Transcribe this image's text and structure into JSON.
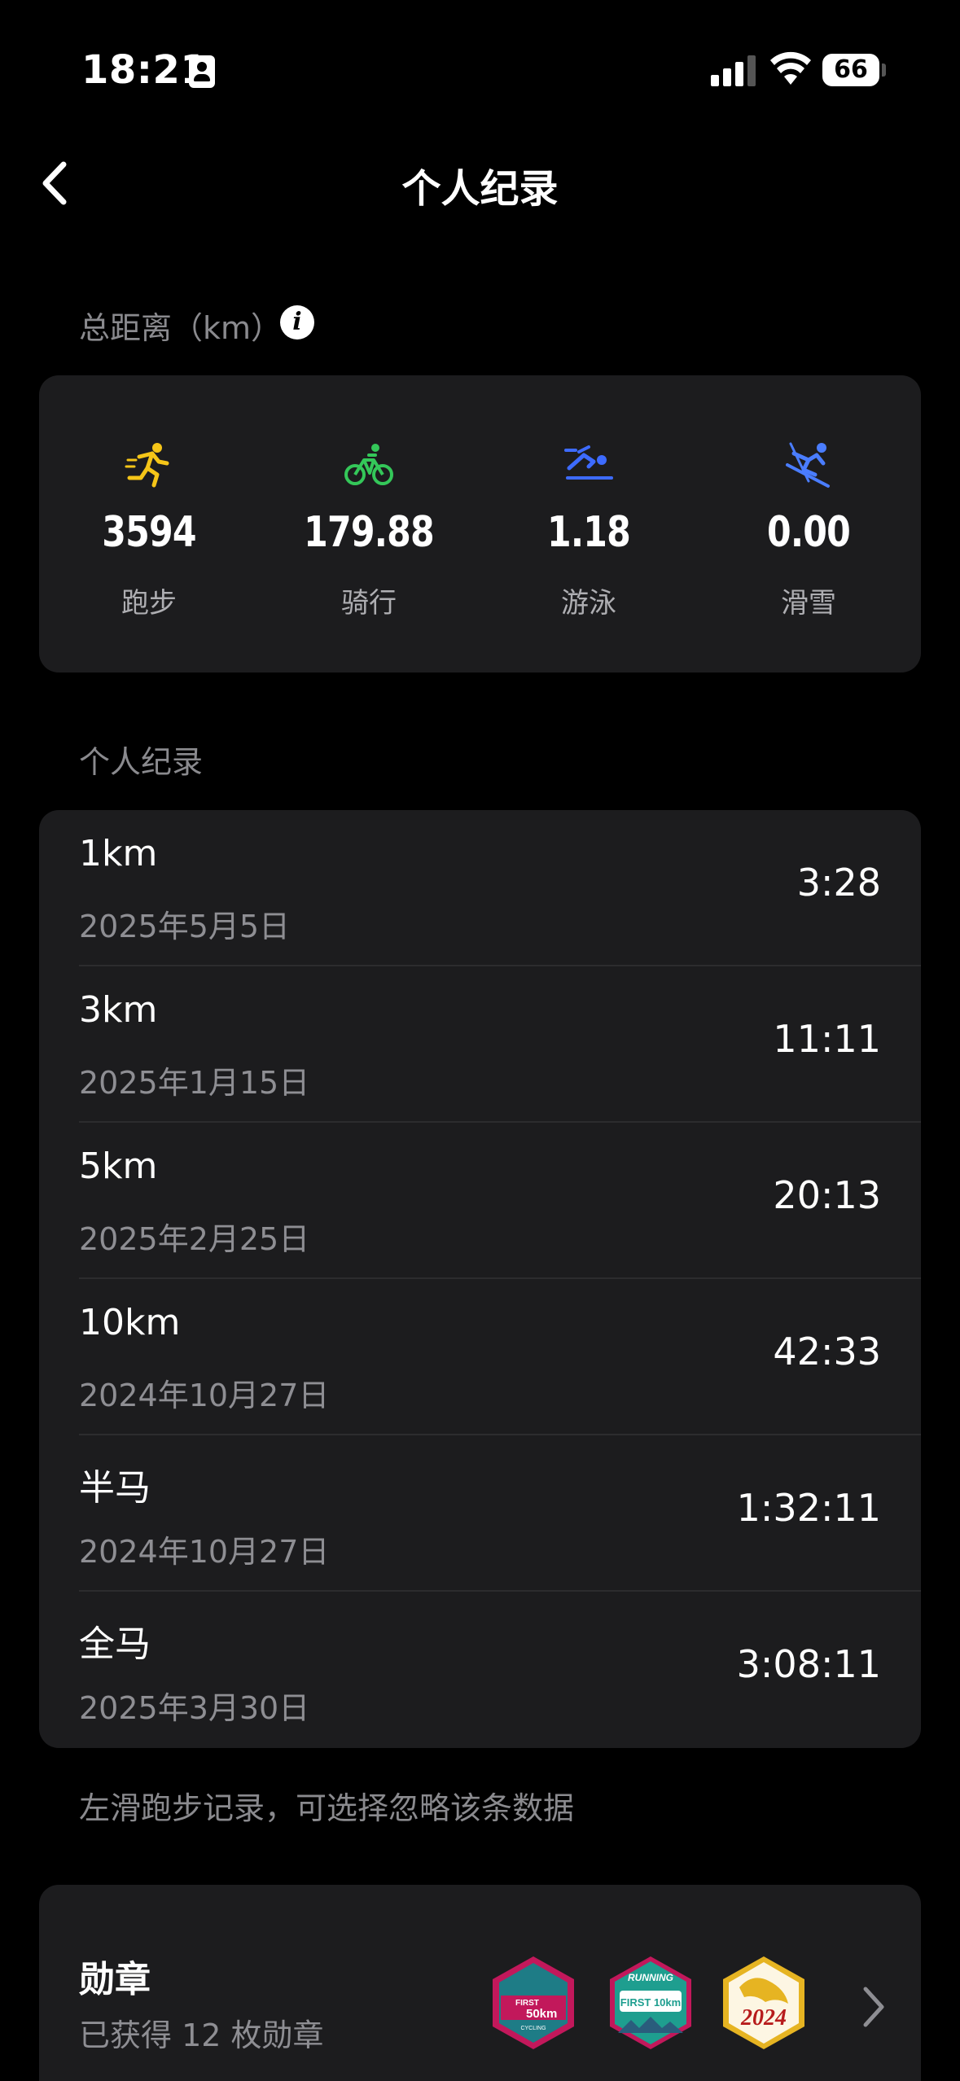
{
  "status_bar": {
    "time": "18:21",
    "battery": "66"
  },
  "nav": {
    "title": "个人纪录"
  },
  "totals": {
    "label": "总距离（km）",
    "items": [
      {
        "value": "3594",
        "label": "跑步",
        "icon": "running-icon",
        "color": "#f5c518"
      },
      {
        "value": "179.88",
        "label": "骑行",
        "icon": "cycling-icon",
        "color": "#34c759"
      },
      {
        "value": "1.18",
        "label": "游泳",
        "icon": "swimming-icon",
        "color": "#3d6bff"
      },
      {
        "value": "0.00",
        "label": "滑雪",
        "icon": "skiing-icon",
        "color": "#4a7dff"
      }
    ]
  },
  "records": {
    "label": "个人纪录",
    "items": [
      {
        "name": "1km",
        "date": "2025年5月5日",
        "time": "3:28"
      },
      {
        "name": "3km",
        "date": "2025年1月15日",
        "time": "11:11"
      },
      {
        "name": "5km",
        "date": "2025年2月25日",
        "time": "20:13"
      },
      {
        "name": "10km",
        "date": "2024年10月27日",
        "time": "42:33"
      },
      {
        "name": "半马",
        "date": "2024年10月27日",
        "time": "1:32:11"
      },
      {
        "name": "全马",
        "date": "2025年3月30日",
        "time": "3:08:11"
      }
    ],
    "hint": "左滑跑步记录，可选择忽略该条数据"
  },
  "medals": {
    "title": "勋章",
    "subtitle": "已获得 12 枚勋章",
    "badges": [
      {
        "top": "FIRST",
        "main": "50km",
        "bottom": "CYCLING",
        "color": "#c2185b"
      },
      {
        "top": "RUNNING",
        "main": "FIRST 10km",
        "color": "#1e9e8f"
      },
      {
        "main": "2024",
        "color": "#e6b422"
      }
    ]
  }
}
